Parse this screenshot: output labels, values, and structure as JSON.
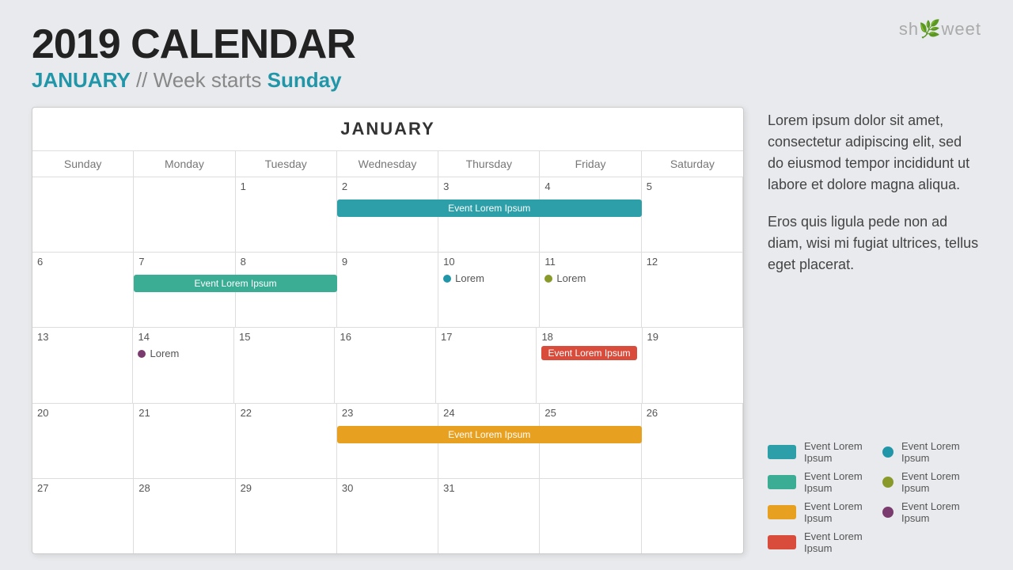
{
  "page": {
    "background": "#e8eaed"
  },
  "header": {
    "main_title": "2019 CALENDAR",
    "subtitle_start": "JANUARY",
    "subtitle_mid": " // Week starts ",
    "subtitle_end": "Sunday"
  },
  "logo": {
    "text": "showeet",
    "leaf": "🌿"
  },
  "calendar": {
    "month_label": "JANUARY",
    "day_names": [
      "Sunday",
      "Monday",
      "Tuesday",
      "Wednesday",
      "Thursday",
      "Friday",
      "Saturday"
    ],
    "weeks": [
      [
        {
          "num": "",
          "events": []
        },
        {
          "num": "",
          "events": []
        },
        {
          "num": "1",
          "events": []
        },
        {
          "num": "2",
          "events": [
            {
              "type": "span-start",
              "label": "Event Lorem Ipsum",
              "color": "teal",
              "span": 3
            }
          ]
        },
        {
          "num": "3",
          "events": []
        },
        {
          "num": "4",
          "events": []
        },
        {
          "num": "5",
          "events": []
        }
      ],
      [
        {
          "num": "6",
          "events": []
        },
        {
          "num": "7",
          "events": [
            {
              "type": "span-start",
              "label": "Event Lorem Ipsum",
              "color": "green",
              "span": 2
            }
          ]
        },
        {
          "num": "8",
          "events": []
        },
        {
          "num": "9",
          "events": []
        },
        {
          "num": "10",
          "events": [
            {
              "type": "dot",
              "label": "Lorem",
              "color": "blue"
            }
          ]
        },
        {
          "num": "11",
          "events": [
            {
              "type": "dot",
              "label": "Lorem",
              "color": "olive"
            }
          ]
        },
        {
          "num": "12",
          "events": []
        }
      ],
      [
        {
          "num": "13",
          "events": []
        },
        {
          "num": "14",
          "events": [
            {
              "type": "dot",
              "label": "Lorem",
              "color": "purple"
            }
          ]
        },
        {
          "num": "15",
          "events": []
        },
        {
          "num": "16",
          "events": []
        },
        {
          "num": "17",
          "events": []
        },
        {
          "num": "18",
          "events": [
            {
              "type": "bar",
              "label": "Event Lorem Ipsum",
              "color": "red"
            }
          ]
        },
        {
          "num": "19",
          "events": []
        }
      ],
      [
        {
          "num": "20",
          "events": []
        },
        {
          "num": "21",
          "events": []
        },
        {
          "num": "22",
          "events": []
        },
        {
          "num": "23",
          "events": [
            {
              "type": "span-start",
              "label": "Event Lorem Ipsum",
              "color": "orange",
              "span": 3
            }
          ]
        },
        {
          "num": "24",
          "events": []
        },
        {
          "num": "25",
          "events": []
        },
        {
          "num": "26",
          "events": []
        }
      ],
      [
        {
          "num": "27",
          "events": []
        },
        {
          "num": "28",
          "events": []
        },
        {
          "num": "29",
          "events": []
        },
        {
          "num": "30",
          "events": []
        },
        {
          "num": "31",
          "events": []
        },
        {
          "num": "",
          "events": []
        },
        {
          "num": "",
          "events": []
        }
      ]
    ]
  },
  "right_panel": {
    "description1": "Lorem ipsum dolor sit amet, consectetur adipiscing elit, sed do eiusmod tempor incididunt ut labore et dolore magna aliqua.",
    "description2": "Eros quis ligula pede non ad diam, wisi mi fugiat ultrices, tellus eget placerat.",
    "legend": [
      {
        "type": "bar",
        "color": "teal",
        "label": "Event Lorem Ipsum"
      },
      {
        "type": "dot",
        "color": "blue",
        "label": "Event Lorem Ipsum"
      },
      {
        "type": "bar",
        "color": "green",
        "label": "Event Lorem Ipsum"
      },
      {
        "type": "dot",
        "color": "olive",
        "label": "Event Lorem Ipsum"
      },
      {
        "type": "bar",
        "color": "orange",
        "label": "Event Lorem Ipsum"
      },
      {
        "type": "dot",
        "color": "purple",
        "label": "Event Lorem Ipsum"
      },
      {
        "type": "bar",
        "color": "red",
        "label": "Event Lorem Ipsum"
      }
    ]
  }
}
